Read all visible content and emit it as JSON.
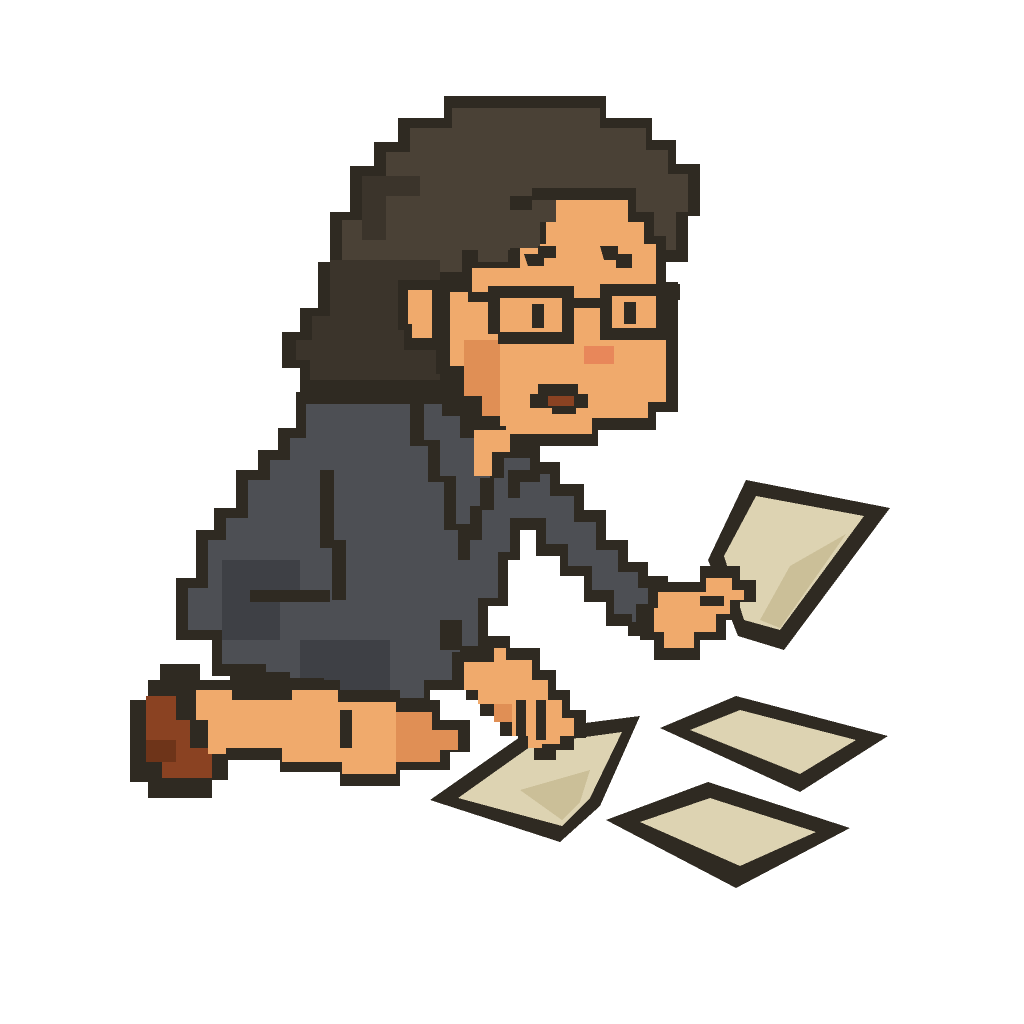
{
  "illustration": {
    "style": "pixel-art",
    "subject_icon": "kneeling-person-picking-up-papers",
    "colors": {
      "background": "#ffffff",
      "outline": "#2f2a22",
      "hair": "#4a4136",
      "hair_shade": "#3b342b",
      "skin": "#f0aa6c",
      "skin_shade": "#e08f55",
      "blush": "#e8875a",
      "jacket": "#4d4f54",
      "jacket_shade": "#3e4045",
      "shoe": "#8a4222",
      "paper": "#ddd3b2",
      "paper_shade": "#cbbf98"
    }
  }
}
